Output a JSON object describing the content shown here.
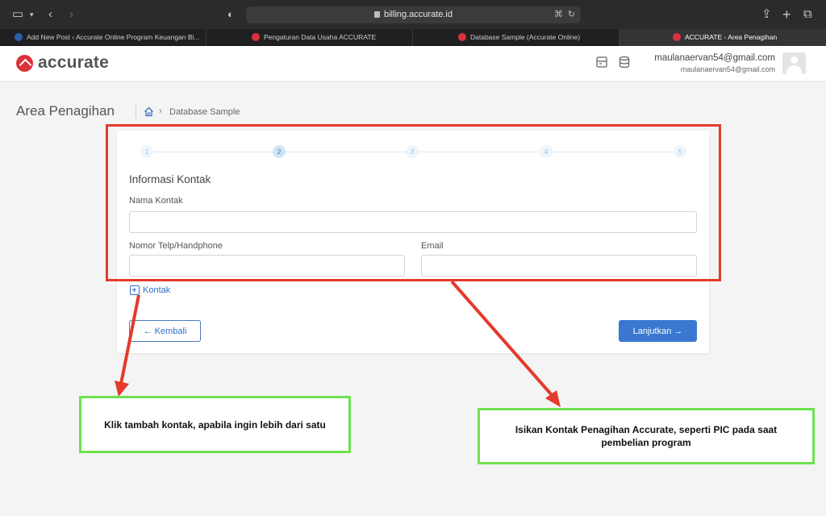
{
  "browser": {
    "url": "billing.accurate.id",
    "tabs": [
      {
        "label": "Add New Post ‹ Accurate Online Program Keuangan Bi...",
        "active": false
      },
      {
        "label": "Pengaturan Data Usaha ACCURATE",
        "active": false
      },
      {
        "label": "Database Sample (Accurate Online)",
        "active": false
      },
      {
        "label": "ACCURATE - Area Penagihan",
        "active": true
      }
    ]
  },
  "header": {
    "logo_text": "accurate",
    "user_email": "maulanaervan54@gmail.com",
    "user_sub": "maulanaervan54@gmail.com"
  },
  "page": {
    "title": "Area Penagihan",
    "breadcrumb": "Database Sample"
  },
  "stepper": {
    "steps": [
      "1",
      "2",
      "3",
      "4",
      "5"
    ],
    "active_step": 2
  },
  "form": {
    "section_title": "Informasi Kontak",
    "name_label": "Nama Kontak",
    "name_value": "",
    "phone_label": "Nomor Telp/Handphone",
    "phone_value": "",
    "email_label": "Email",
    "email_value": "",
    "add_contact_label": "Kontak",
    "back_label": "← Kembali",
    "next_label": "Lanjutkan →"
  },
  "annotations": {
    "left_note": "Klik tambah kontak, apabila ingin lebih dari satu",
    "right_note": "Isikan Kontak Penagihan Accurate, seperti PIC pada saat pembelian program",
    "colors": {
      "red": "#e53a2c",
      "green": "#6ee24e"
    }
  }
}
